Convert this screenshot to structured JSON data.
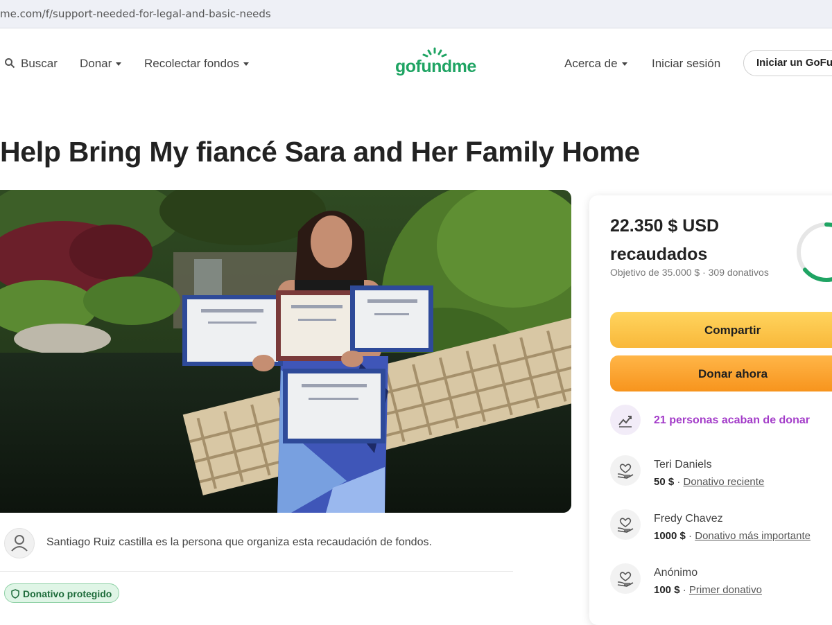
{
  "browser": {
    "url": "me.com/f/support-needed-for-legal-and-basic-needs"
  },
  "nav": {
    "search_label": "Buscar",
    "donate_label": "Donar",
    "fundraise_label": "Recolectar fondos",
    "logo": "gofundme",
    "about_label": "Acerca de",
    "login_label": "Iniciar sesión",
    "start_label": "Iniciar un GoFu"
  },
  "campaign": {
    "title": "Help Bring My fiancé Sara and Her Family Home",
    "organizer_text": "Santiago Ruiz castilla es la persona que organiza esta recaudación de fondos.",
    "protected_badge": "Donativo protegido"
  },
  "progress": {
    "raised": "22.350 $ USD",
    "raised_label": "recaudados",
    "goal_text": "Objetivo de 35.000 $ · 309 donativos",
    "percent_label": "64",
    "percent_value": 0.64,
    "accent_color": "#1fa463"
  },
  "actions": {
    "share_label": "Compartir",
    "donate_now_label": "Donar ahora"
  },
  "recent": {
    "text": "21 personas acaban de donar",
    "color": "#a33cc9"
  },
  "donations": [
    {
      "name": "Teri Daniels",
      "amount": "50 $",
      "type": "Donativo reciente"
    },
    {
      "name": "Fredy Chavez",
      "amount": "1000 $",
      "type": "Donativo más importante"
    },
    {
      "name": "Anónimo",
      "amount": "100 $",
      "type": "Primer donativo"
    }
  ]
}
